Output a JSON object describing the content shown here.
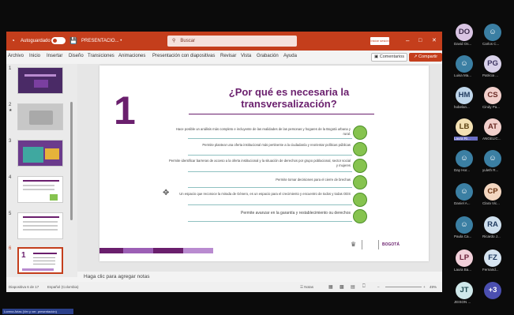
{
  "titlebar": {
    "autosave_label": "Autoguardado",
    "doc_name": "PRESENTACIO... •",
    "search_placeholder": "Buscar",
    "account_label": "Iniciar sesión",
    "minimize": "–",
    "restore": "□",
    "close": "✕"
  },
  "menu": [
    "Archivo",
    "Inicio",
    "Insertar",
    "Diseño",
    "Transiciones",
    "Animaciones",
    "Presentación con diapositivas",
    "Revisar",
    "Vista",
    "Grabación",
    "Ayuda"
  ],
  "comments_label": "Comentarios",
  "share_label": "Compartir",
  "thumbnails": [
    {
      "num": "1",
      "marker": ""
    },
    {
      "num": "2",
      "marker": "★"
    },
    {
      "num": "3",
      "marker": ""
    },
    {
      "num": "4",
      "marker": ""
    },
    {
      "num": "5",
      "marker": ""
    },
    {
      "num": "6",
      "marker": ""
    }
  ],
  "slide": {
    "number": "1",
    "title": "¿Por qué es necesaria la\ntransversalización?",
    "bullets": [
      "Hace posible un análisis más completo e incluyente de las realidades de las personas y hogares de la Bogotá urbana y rural.",
      "Permite plantear una oferta institucional más pertinente a la ciudadanía y reorientar políticas públicas",
      "Permite identificar barreras de acceso a la oferta institucional y la situación de derechos por grupo poblacional, sector social y mujeres",
      "Permite tomar decisiones para el cierre de brechas",
      "Un espacio que reconoce la mirada de Género, es un espacio para el crecimiento y encuentro de todos y todas ODS",
      "Permite avanzar en la garantía y restablecimiento ou derechos"
    ],
    "logo_text": "BOGOTÁ"
  },
  "notes_placeholder": "Haga clic para agregar notas",
  "status": {
    "slide_count": "Diapositiva 6 de 17",
    "language": "Español (Colombia)",
    "notes_label": "Notas",
    "zoom": "49%"
  },
  "participants": [
    {
      "initials": "DO",
      "name": "David Os...",
      "bg": "#d9c4e3",
      "fg": "#3c2a4a"
    },
    {
      "initials": "☺",
      "name": "Carlos C...",
      "bg": "#3b7fa3",
      "fg": "#ffffff"
    },
    {
      "initials": "☺",
      "name": "Luisa Ma...",
      "bg": "#3b7fa3",
      "fg": "#ffffff"
    },
    {
      "initials": "PG",
      "name": "Patricia ...",
      "bg": "#d9d2ea",
      "fg": "#3a3260"
    },
    {
      "initials": "HM",
      "name": "hobelan...",
      "bg": "#bfd6ea",
      "fg": "#1f3a5f"
    },
    {
      "initials": "CS",
      "name": "Cindy Pa...",
      "bg": "#f2d0cc",
      "fg": "#6a2a24"
    },
    {
      "initials": "LB",
      "name": "Laura Ri...",
      "bg": "#f3e0b3",
      "fg": "#5a4010"
    },
    {
      "initials": "AT",
      "name": "ANGELIC...",
      "bg": "#f2d0cc",
      "fg": "#6a2a24"
    },
    {
      "initials": "☺",
      "name": "Day Hor...",
      "bg": "#3b7fa3",
      "fg": "#ffffff"
    },
    {
      "initials": "☺",
      "name": "yuleth R...",
      "bg": "#3b7fa3",
      "fg": "#ffffff"
    },
    {
      "initials": "☺",
      "name": "Daniel A...",
      "bg": "#3b7fa3",
      "fg": "#ffffff"
    },
    {
      "initials": "CP",
      "name": "Clara Vic...",
      "bg": "#f3d6c0",
      "fg": "#6a3210"
    },
    {
      "initials": "☺",
      "name": "Paula Ca...",
      "bg": "#3b7fa3",
      "fg": "#ffffff"
    },
    {
      "initials": "RA",
      "name": "Ricardo J...",
      "bg": "#cfe0ee",
      "fg": "#1f3a5f"
    },
    {
      "initials": "LP",
      "name": "Laura Ba...",
      "bg": "#f2d0da",
      "fg": "#6a1f3a"
    },
    {
      "initials": "FZ",
      "name": "Fernand...",
      "bg": "#d6e4f0",
      "fg": "#1f3a5f"
    },
    {
      "initials": "JT",
      "name": "JEISON ...",
      "bg": "#cfe8ea",
      "fg": "#1f4a50"
    },
    {
      "initials": "+3",
      "name": "",
      "bg": "#4b4fb0",
      "fg": "#ffffff"
    }
  ],
  "bottom_tag": "Lorena Arias (Ver y ver. presentación)"
}
